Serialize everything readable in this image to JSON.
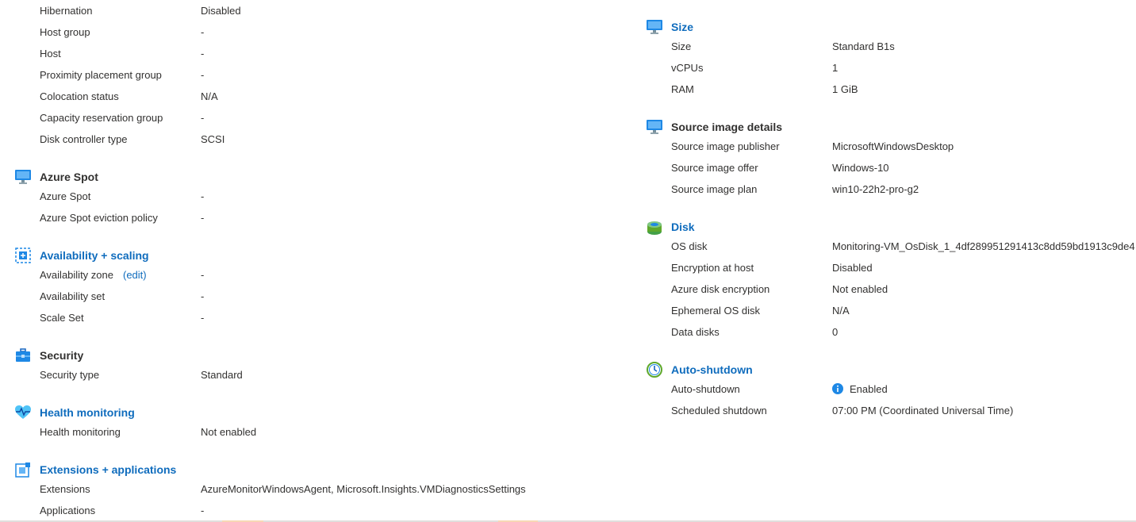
{
  "left_top_rows": [
    {
      "label": "Hibernation",
      "value": "Disabled"
    },
    {
      "label": "Host group",
      "value": "-"
    },
    {
      "label": "Host",
      "value": "-"
    },
    {
      "label": "Proximity placement group",
      "value": "-"
    },
    {
      "label": "Colocation status",
      "value": "N/A"
    },
    {
      "label": "Capacity reservation group",
      "value": "-"
    },
    {
      "label": "Disk controller type",
      "value": "SCSI"
    }
  ],
  "azure_spot": {
    "title": "Azure Spot",
    "icon": "monitor-icon",
    "rows": [
      {
        "label": "Azure Spot",
        "value": "-"
      },
      {
        "label": "Azure Spot eviction policy",
        "value": "-"
      }
    ]
  },
  "availability": {
    "title": "Availability + scaling",
    "icon": "availability-scaling-icon",
    "edit_label": "(edit)",
    "rows": [
      {
        "label": "Availability zone",
        "value": "-"
      },
      {
        "label": "Availability set",
        "value": "-"
      },
      {
        "label": "Scale Set",
        "value": "-"
      }
    ]
  },
  "security": {
    "title": "Security",
    "icon": "briefcase-icon",
    "rows": [
      {
        "label": "Security type",
        "value": "Standard"
      }
    ]
  },
  "health": {
    "title": "Health monitoring",
    "icon": "heart-pulse-icon",
    "rows": [
      {
        "label": "Health monitoring",
        "value": "Not enabled"
      }
    ]
  },
  "extensions": {
    "title": "Extensions + applications",
    "icon": "extensions-icon",
    "rows": [
      {
        "label": "Extensions",
        "value": "AzureMonitorWindowsAgent, Microsoft.Insights.VMDiagnosticsSettings"
      },
      {
        "label": "Applications",
        "value": "-"
      }
    ]
  },
  "size": {
    "title": "Size",
    "icon": "monitor-icon",
    "rows": [
      {
        "label": "Size",
        "value": "Standard B1s"
      },
      {
        "label": "vCPUs",
        "value": "1"
      },
      {
        "label": "RAM",
        "value": "1 GiB"
      }
    ]
  },
  "source_image": {
    "title": "Source image details",
    "icon": "monitor-icon",
    "rows": [
      {
        "label": "Source image publisher",
        "value": "MicrosoftWindowsDesktop"
      },
      {
        "label": "Source image offer",
        "value": "Windows-10"
      },
      {
        "label": "Source image plan",
        "value": "win10-22h2-pro-g2"
      }
    ]
  },
  "disk": {
    "title": "Disk",
    "icon": "disk-icon",
    "rows": [
      {
        "label": "OS disk",
        "value": "Monitoring-VM_OsDisk_1_4df289951291413c8dd59bd1913c9de4"
      },
      {
        "label": "Encryption at host",
        "value": "Disabled"
      },
      {
        "label": "Azure disk encryption",
        "value": "Not enabled"
      },
      {
        "label": "Ephemeral OS disk",
        "value": "N/A"
      },
      {
        "label": "Data disks",
        "value": "0"
      }
    ]
  },
  "auto_shutdown": {
    "title": "Auto-shutdown",
    "icon": "clock-icon",
    "rows": [
      {
        "label": "Auto-shutdown",
        "value": "Enabled"
      },
      {
        "label": "Scheduled shutdown",
        "value": "07:00 PM (Coordinated Universal Time)"
      }
    ]
  },
  "colors": {
    "link": "#0f6cbd",
    "text": "#323130",
    "icon_blue": "#1e88e5",
    "icon_green": "#5ea82b"
  }
}
